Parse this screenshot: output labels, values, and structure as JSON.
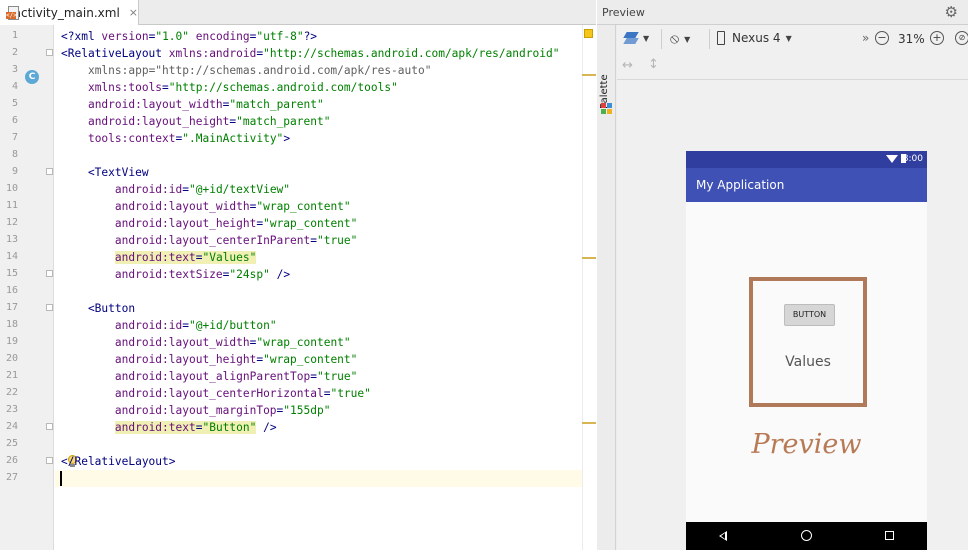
{
  "editor": {
    "tab_label": "activity_main.xml",
    "tab_close": "×",
    "gutter_badge": "C",
    "line_numbers": [
      "1",
      "2",
      "3",
      "4",
      "5",
      "6",
      "7",
      "8",
      "9",
      "10",
      "11",
      "12",
      "13",
      "14",
      "15",
      "16",
      "17",
      "18",
      "19",
      "20",
      "21",
      "22",
      "23",
      "24",
      "25",
      "26",
      "27"
    ],
    "lines": [
      [
        [
          "tg",
          "<?xml "
        ],
        [
          "an",
          "version"
        ],
        [
          "tg",
          "="
        ],
        [
          "av",
          "\"1.0\""
        ],
        [
          "tg",
          " "
        ],
        [
          "an",
          "encoding"
        ],
        [
          "tg",
          "="
        ],
        [
          "av",
          "\"utf-8\""
        ],
        [
          "tg",
          "?>"
        ]
      ],
      [
        [
          "tg",
          "<RelativeLayout "
        ],
        [
          "an",
          "xmlns:android"
        ],
        [
          "tg",
          "="
        ],
        [
          "av",
          "\"http://schemas.android.com/apk/res/android\""
        ]
      ],
      [
        [
          "tg",
          "    "
        ],
        [
          "nx",
          "xmlns:app=\"http://schemas.android.com/apk/res-auto\""
        ]
      ],
      [
        [
          "tg",
          "    "
        ],
        [
          "an",
          "xmlns:tools"
        ],
        [
          "tg",
          "="
        ],
        [
          "av",
          "\"http://schemas.android.com/tools\""
        ]
      ],
      [
        [
          "tg",
          "    "
        ],
        [
          "an",
          "android:layout_width"
        ],
        [
          "tg",
          "="
        ],
        [
          "av",
          "\"match_parent\""
        ]
      ],
      [
        [
          "tg",
          "    "
        ],
        [
          "an",
          "android:layout_height"
        ],
        [
          "tg",
          "="
        ],
        [
          "av",
          "\"match_parent\""
        ]
      ],
      [
        [
          "tg",
          "    "
        ],
        [
          "an",
          "tools:context"
        ],
        [
          "tg",
          "="
        ],
        [
          "av",
          "\".MainActivity\""
        ],
        [
          "tg",
          ">"
        ]
      ],
      [],
      [
        [
          "tg",
          "    <TextView"
        ]
      ],
      [
        [
          "tg",
          "        "
        ],
        [
          "an",
          "android:id"
        ],
        [
          "tg",
          "="
        ],
        [
          "av",
          "\"@+id/textView\""
        ]
      ],
      [
        [
          "tg",
          "        "
        ],
        [
          "an",
          "android:layout_width"
        ],
        [
          "tg",
          "="
        ],
        [
          "av",
          "\"wrap_content\""
        ]
      ],
      [
        [
          "tg",
          "        "
        ],
        [
          "an",
          "android:layout_height"
        ],
        [
          "tg",
          "="
        ],
        [
          "av",
          "\"wrap_content\""
        ]
      ],
      [
        [
          "tg",
          "        "
        ],
        [
          "an",
          "android:layout_centerInParent"
        ],
        [
          "tg",
          "="
        ],
        [
          "av",
          "\"true\""
        ]
      ],
      [
        [
          "tg",
          "        "
        ],
        [
          "an hl",
          "android:text"
        ],
        [
          "tg hl",
          "="
        ],
        [
          "av hl",
          "\"Values\""
        ]
      ],
      [
        [
          "tg",
          "        "
        ],
        [
          "an",
          "android:textSize"
        ],
        [
          "tg",
          "="
        ],
        [
          "av",
          "\"24sp\""
        ],
        [
          "tg",
          " />"
        ]
      ],
      [],
      [
        [
          "tg",
          "    <Button"
        ]
      ],
      [
        [
          "tg",
          "        "
        ],
        [
          "an",
          "android:id"
        ],
        [
          "tg",
          "="
        ],
        [
          "av",
          "\"@+id/button\""
        ]
      ],
      [
        [
          "tg",
          "        "
        ],
        [
          "an",
          "android:layout_width"
        ],
        [
          "tg",
          "="
        ],
        [
          "av",
          "\"wrap_content\""
        ]
      ],
      [
        [
          "tg",
          "        "
        ],
        [
          "an",
          "android:layout_height"
        ],
        [
          "tg",
          "="
        ],
        [
          "av",
          "\"wrap_content\""
        ]
      ],
      [
        [
          "tg",
          "        "
        ],
        [
          "an",
          "android:layout_alignParentTop"
        ],
        [
          "tg",
          "="
        ],
        [
          "av",
          "\"true\""
        ]
      ],
      [
        [
          "tg",
          "        "
        ],
        [
          "an",
          "android:layout_centerHorizontal"
        ],
        [
          "tg",
          "="
        ],
        [
          "av",
          "\"true\""
        ]
      ],
      [
        [
          "tg",
          "        "
        ],
        [
          "an",
          "android:layout_marginTop"
        ],
        [
          "tg",
          "="
        ],
        [
          "av",
          "\"155dp\""
        ]
      ],
      [
        [
          "tg",
          "        "
        ],
        [
          "an hl",
          "android:text"
        ],
        [
          "tg hl",
          "="
        ],
        [
          "av hl",
          "\"Button\""
        ],
        [
          "tg",
          " />"
        ]
      ],
      [],
      [
        [
          "tg",
          "</RelativeLayout>"
        ]
      ],
      []
    ],
    "colors": {
      "tag": "#000080",
      "attr": "#660e7a",
      "value": "#008000",
      "highlight": "#f0f0b5"
    }
  },
  "preview": {
    "title": "Preview",
    "palette_label": "Palette",
    "device": "Nexus 4",
    "zoom": "31%",
    "overflow": "»",
    "zoom_in": "+",
    "zoom_out": "−",
    "phone": {
      "status_time": "8:00",
      "app_title": "My Application",
      "button_label": "BUTTON",
      "text_value": "Values",
      "overlay_caption": "Preview",
      "colors": {
        "status": "#303f9f",
        "appbar": "#3f51b5",
        "frame": "#b07a5a",
        "caption": "#b87a55"
      }
    }
  }
}
